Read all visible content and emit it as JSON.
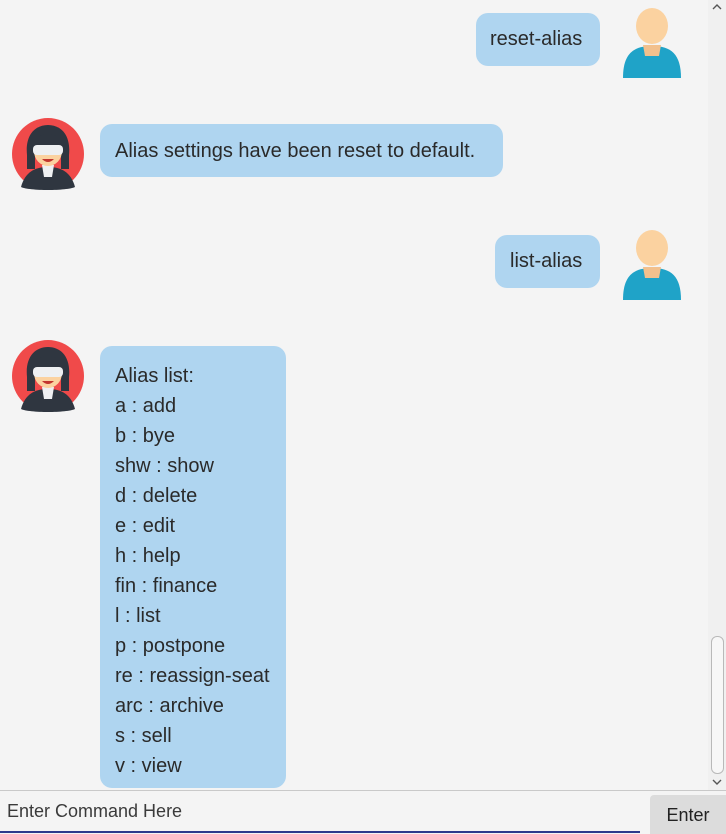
{
  "messages": [
    {
      "sender": "user",
      "text": "reset-alias"
    },
    {
      "sender": "bot",
      "text": "Alias settings have been reset to default."
    },
    {
      "sender": "user",
      "text": "list-alias"
    },
    {
      "sender": "bot",
      "lines": [
        "Alias list:",
        "a : add",
        "b : bye",
        "shw : show",
        "d : delete",
        "e : edit",
        "h : help",
        "fin : finance",
        "l : list",
        "p : postpone",
        "re : reassign-seat",
        "arc : archive",
        "s : sell",
        "v : view"
      ]
    }
  ],
  "input": {
    "placeholder": "Enter Command Here",
    "value": ""
  },
  "enter_button": {
    "label": "Enter"
  },
  "colors": {
    "bubble": "#afd5f0",
    "background": "#f4f4f4",
    "user_avatar_body": "#1fa3c8",
    "user_avatar_head": "#fbd2a0",
    "bot_avatar_circle": "#f04a4a",
    "input_underline": "#2d3a8c"
  },
  "icons": {
    "user_avatar": "user-avatar-icon",
    "bot_avatar": "bot-avatar-icon",
    "scroll_up": "scroll-up-arrow-icon",
    "scroll_down": "scroll-down-arrow-icon"
  }
}
